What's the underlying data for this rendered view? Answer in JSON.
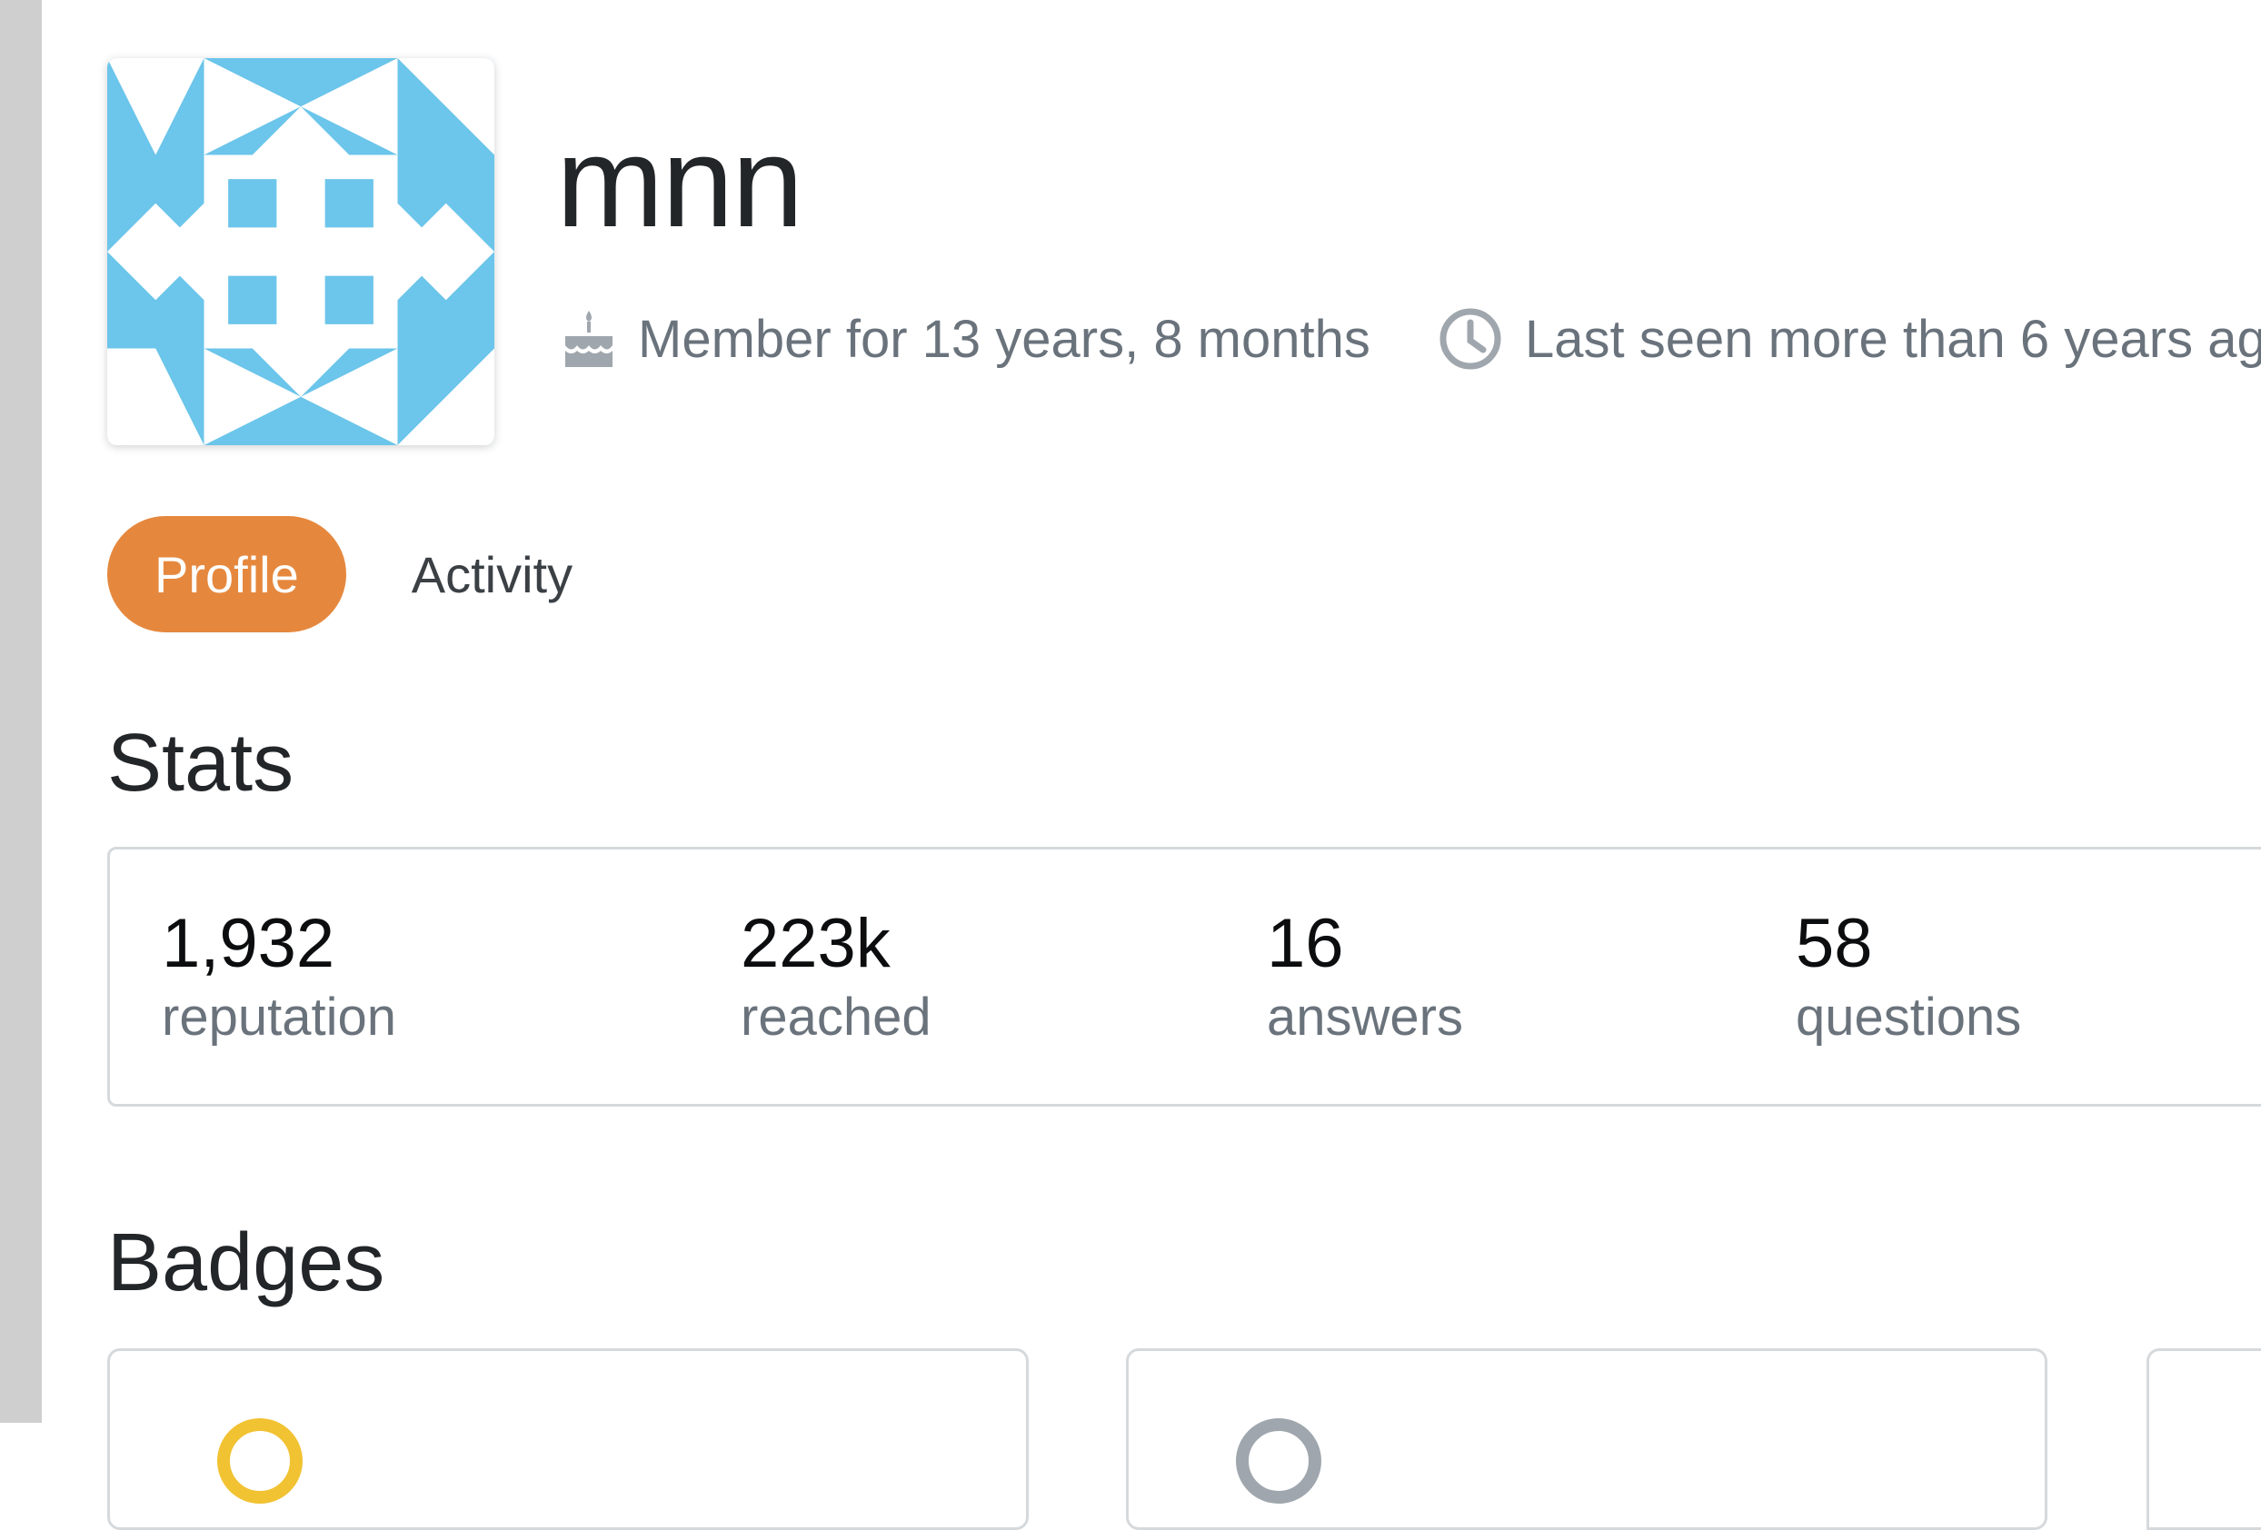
{
  "user": {
    "name": "mnn",
    "member_for": "Member for 13 years, 8 months",
    "last_seen": "Last seen more than 6 years ag"
  },
  "icons": {
    "member": "cake-icon",
    "last_seen": "clock-icon",
    "badge_gold": "gold-badge-icon",
    "badge_silver": "silver-badge-icon"
  },
  "colors": {
    "accent": "#e5883e",
    "avatar_blue": "#6cc5ea",
    "gold": "#f1c232",
    "silver": "#9fa6ad"
  },
  "tabs": [
    {
      "label": "Profile",
      "active": true
    },
    {
      "label": "Activity",
      "active": false
    }
  ],
  "stats": {
    "title": "Stats",
    "items": [
      {
        "value": "1,932",
        "label": "reputation"
      },
      {
        "value": "223k",
        "label": "reached"
      },
      {
        "value": "16",
        "label": "answers"
      },
      {
        "value": "58",
        "label": "questions"
      }
    ]
  },
  "badges": {
    "title": "Badges"
  }
}
